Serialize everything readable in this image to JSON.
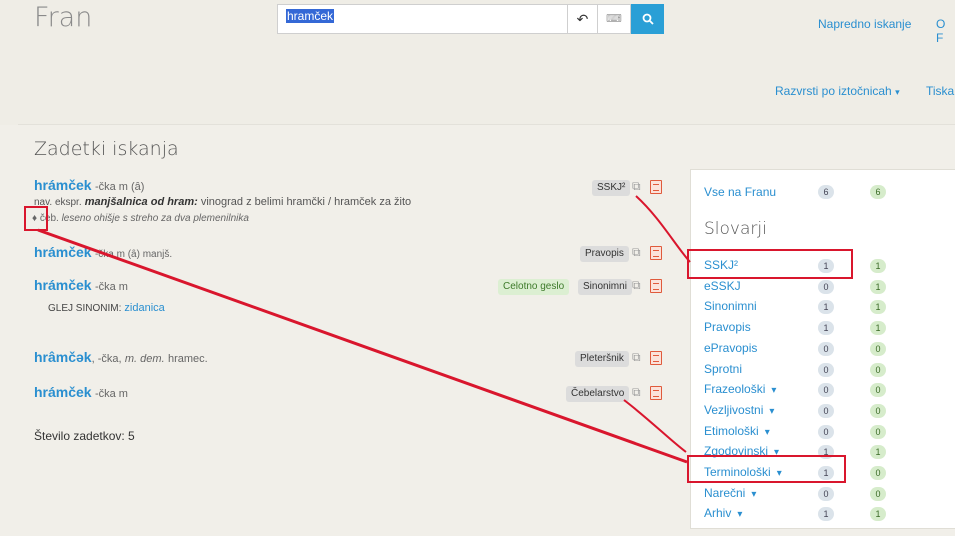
{
  "app": {
    "logo": "Fran"
  },
  "search": {
    "query": "hramček"
  },
  "toolbar": {
    "history_icon": "↶",
    "keyboard_icon": "⌨",
    "search_icon": "🔍"
  },
  "nav": {
    "advanced": "Napredno iskanje",
    "about": "O F",
    "sort": "Razvrsti po iztočnicah",
    "sort_caret": "▾",
    "print": "Tiskan"
  },
  "results": {
    "title": "Zadetki iskanja",
    "count_label": "Število zadetkov: 5",
    "entries": [
      {
        "headword": "hrámček",
        "grammar": "-čka m (ȃ)",
        "def_prefix": "nav. ekspr.",
        "def_emph": "manjšalnica od hram:",
        "def_rest": "vinograd z belimi hramčki / hramček za žito",
        "extra_bullet": "♦",
        "extra_label": "čeb.",
        "extra_text": "leseno ohišje s streho za dva plemenilnika",
        "tags": [
          "SSKJ²"
        ]
      },
      {
        "headword": "hrámček",
        "grammar": "-čka m (ȃ) manjš.",
        "tags": [
          "Pravopis"
        ]
      },
      {
        "headword": "hrámček",
        "grammar": "-čka m",
        "see_label": "GLEJ SINONIM:",
        "see_link": "zidanica",
        "tags": [
          "Celotno geslo",
          "Sinonimni"
        ]
      },
      {
        "headword": "hrâmčǝk",
        "grammar": ", -čka,",
        "grammar_italic": "m. dem.",
        "grammar_tail": "hramec.",
        "tags": [
          "Pleteršnik"
        ]
      },
      {
        "headword": "hrámček",
        "grammar": "-čka m",
        "tags": [
          "Čebelarstvo"
        ]
      }
    ],
    "copy_icon": "⧉"
  },
  "sidebar": {
    "all_label": "Vse na Franu",
    "all_count_a": "6",
    "all_count_b": "6",
    "title": "Slovarji",
    "dictionaries": [
      {
        "label": "SSKJ²",
        "a": "1",
        "b": "1",
        "caret": ""
      },
      {
        "label": "eSSKJ",
        "a": "0",
        "b": "1",
        "caret": ""
      },
      {
        "label": "Sinonimni",
        "a": "1",
        "b": "1",
        "caret": ""
      },
      {
        "label": "Pravopis",
        "a": "1",
        "b": "1",
        "caret": ""
      },
      {
        "label": "ePravopis",
        "a": "0",
        "b": "0",
        "caret": ""
      },
      {
        "label": "Sprotni",
        "a": "0",
        "b": "0",
        "caret": ""
      },
      {
        "label": "Frazeološki",
        "a": "0",
        "b": "0",
        "caret": "▾"
      },
      {
        "label": "Vezljivostni",
        "a": "0",
        "b": "0",
        "caret": "▾"
      },
      {
        "label": "Etimološki",
        "a": "0",
        "b": "0",
        "caret": "▾"
      },
      {
        "label": "Zgodovinski",
        "a": "1",
        "b": "1",
        "caret": "▾"
      },
      {
        "label": "Terminološki",
        "a": "1",
        "b": "0",
        "caret": "▾"
      },
      {
        "label": "Narečni",
        "a": "0",
        "b": "0",
        "caret": "▾"
      },
      {
        "label": "Arhiv",
        "a": "1",
        "b": "1",
        "caret": "▾"
      }
    ]
  },
  "annotation_color": "#d9162d"
}
